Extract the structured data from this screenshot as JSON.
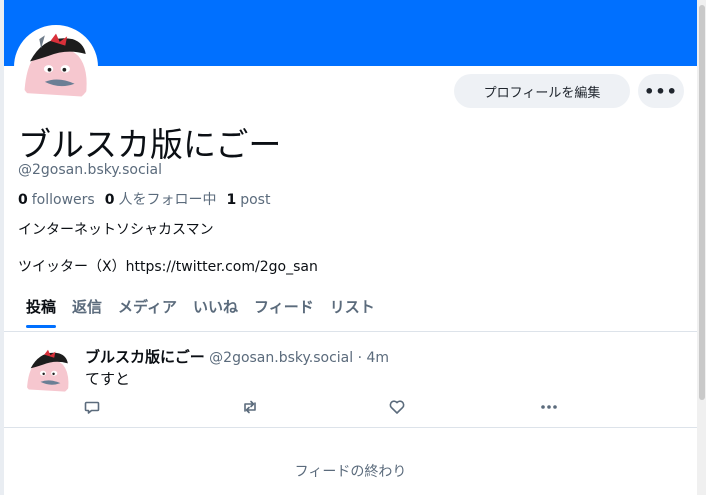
{
  "colors": {
    "banner": "#0070ff",
    "accent": "#0070ff",
    "muted_text": "#5b6b7c",
    "button_bg": "#eef1f5"
  },
  "header": {
    "edit_profile_label": "プロフィールを編集",
    "more_label": "•••"
  },
  "profile": {
    "display_name": "ブルスカ版にごー",
    "handle": "@2gosan.bsky.social",
    "followers_count": "0",
    "followers_label": "followers",
    "following_count": "0",
    "following_label": "人をフォロー中",
    "posts_count": "1",
    "posts_label": "post",
    "bio_line1": "インターネットソシャカスマン",
    "bio_line2": "ツイッター（X）https://twitter.com/2go_san"
  },
  "tabs": [
    {
      "label": "投稿",
      "active": true
    },
    {
      "label": "返信",
      "active": false
    },
    {
      "label": "メディア",
      "active": false
    },
    {
      "label": "いいね",
      "active": false
    },
    {
      "label": "フィード",
      "active": false
    },
    {
      "label": "リスト",
      "active": false
    }
  ],
  "feed": {
    "posts": [
      {
        "author_name": "ブルスカ版にごー",
        "author_handle": "@2gosan.bsky.social",
        "separator": "·",
        "time": "4m",
        "text": "てすと",
        "actions": [
          "reply-icon",
          "repost-icon",
          "like-icon",
          "more-icon"
        ]
      }
    ],
    "end_label": "フィードの終わり"
  }
}
